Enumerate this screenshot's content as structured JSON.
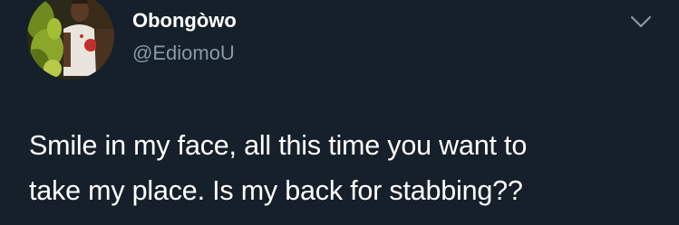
{
  "user": {
    "display_name": "Obongòwo",
    "handle": "@EdiomoU",
    "avatar_icon": "profile-photo"
  },
  "menu": {
    "icon": "chevron-down-icon"
  },
  "tweet": {
    "lines": [
      "Smile in my face, all this time you want to",
      "take my place. Is my back for stabbing??"
    ]
  },
  "colors": {
    "background": "#15202b",
    "text": "#ffffff",
    "secondary_text": "#8899a6",
    "icon": "#8899a6"
  }
}
